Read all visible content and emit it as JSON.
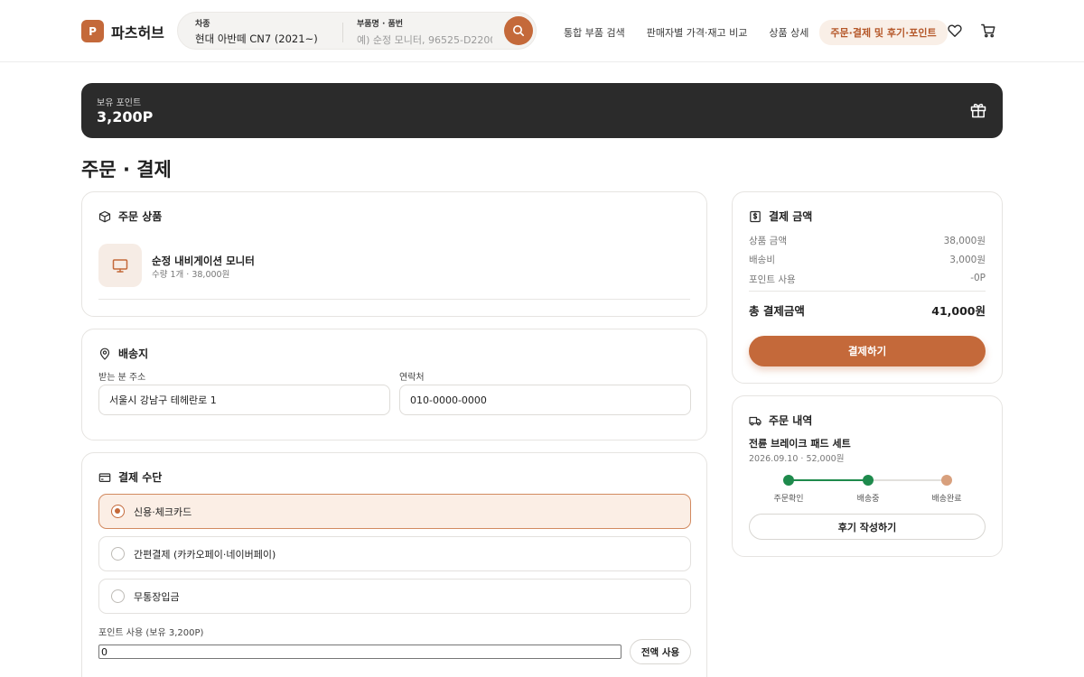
{
  "brand": {
    "logo_letter": "P",
    "name": "파츠허브"
  },
  "search": {
    "car_label": "차종",
    "car_value": "현대 아반떼 CN7 (2021~)",
    "part_label": "부품명 · 품번",
    "part_placeholder": "예) 순정 모니터, 96525-D2200"
  },
  "nav": {
    "items": [
      {
        "label": "통합 부품 검색",
        "active": false
      },
      {
        "label": "판매자별 가격·재고 비교",
        "active": false
      },
      {
        "label": "상품 상세",
        "active": false
      },
      {
        "label": "주문·결제 및 후기·포인트",
        "active": true
      }
    ]
  },
  "points_banner": {
    "label": "보유 포인트",
    "value": "3,200P"
  },
  "page_title": "주문 · 결제",
  "order_items": {
    "title": "주문 상품",
    "product": {
      "name": "순정 내비게이션 모니터",
      "meta": "수량 1개 · 38,000원"
    }
  },
  "shipping": {
    "title": "배송지",
    "address_label": "받는 분 주소",
    "address_value": "서울시 강남구 테헤란로 1",
    "phone_label": "연락처",
    "phone_value": "010-0000-0000"
  },
  "payment_method": {
    "title": "결제 수단",
    "options": [
      {
        "label": "신용·체크카드",
        "selected": true
      },
      {
        "label": "간편결제 (카카오페이·네이버페이)",
        "selected": false
      },
      {
        "label": "무통장입금",
        "selected": false
      }
    ],
    "points_label": "포인트 사용 (보유 3,200P)",
    "points_value": "0",
    "use_all_label": "전액 사용"
  },
  "summary": {
    "title": "결제 금액",
    "rows": [
      {
        "label": "상품 금액",
        "value": "38,000원"
      },
      {
        "label": "배송비",
        "value": "3,000원"
      },
      {
        "label": "포인트 사용",
        "value": "-0P"
      }
    ],
    "total_label": "총 결제금액",
    "total_value": "41,000원",
    "pay_button": "결제하기"
  },
  "order_history": {
    "title": "주문 내역",
    "item_name": "전륜 브레이크 패드 세트",
    "item_meta": "2026.09.10 · 52,000원",
    "steps": [
      {
        "label": "주문확인",
        "done": true
      },
      {
        "label": "배송중",
        "done": true
      },
      {
        "label": "배송완료",
        "done": false
      }
    ],
    "review_button": "후기 작성하기"
  },
  "colors": {
    "accent": "#c4693a",
    "dark_banner": "#2b2b2b",
    "done": "#1e8a4c",
    "pending": "#d8a07d"
  }
}
